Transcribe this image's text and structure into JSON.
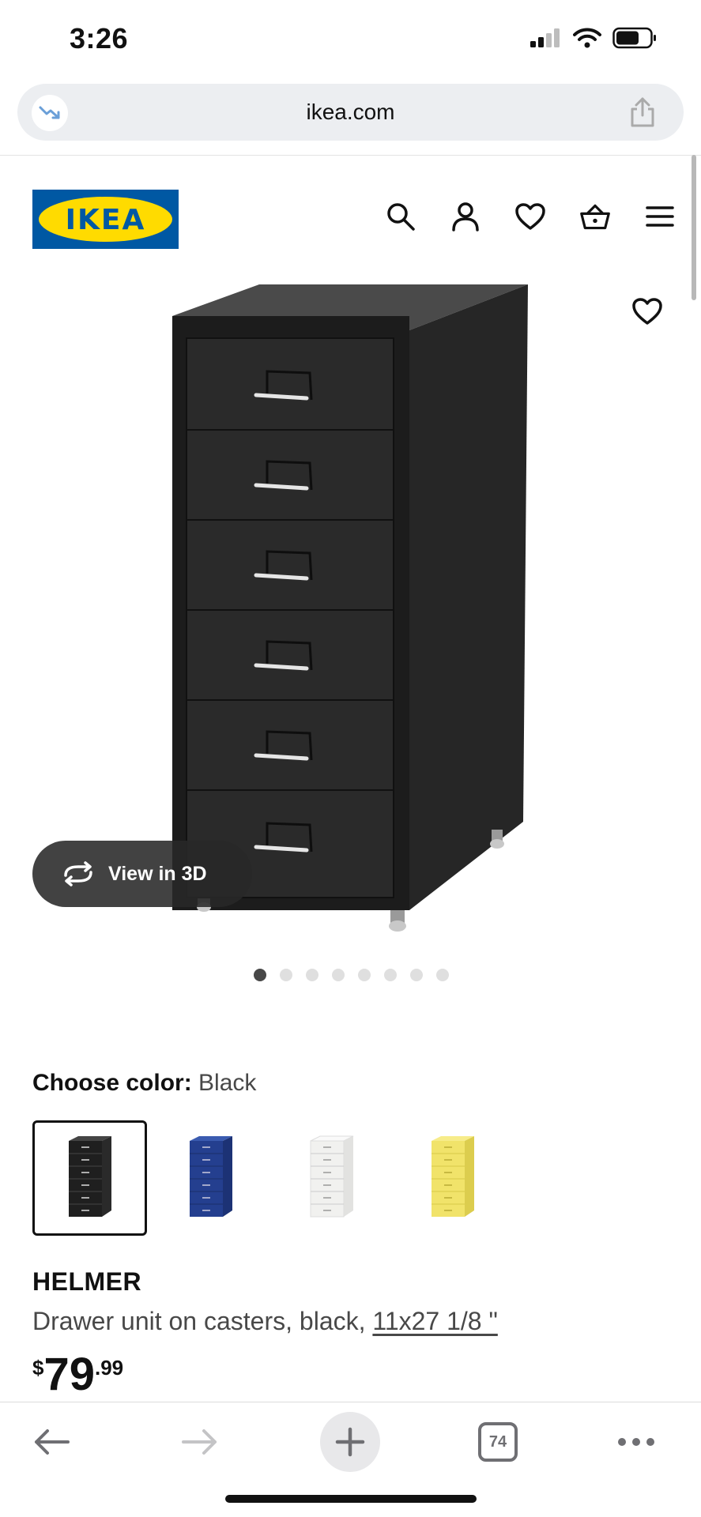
{
  "status_bar": {
    "time": "3:26"
  },
  "browser": {
    "url": "ikea.com",
    "tab_count": "74"
  },
  "header": {
    "logo_text": "IKEA",
    "icons": [
      "search-icon",
      "account-icon",
      "favorites-icon",
      "basket-icon",
      "menu-icon"
    ]
  },
  "gallery": {
    "view_3d_label": "View in 3D",
    "image_count": 8,
    "active_index": 0
  },
  "color_choice": {
    "label": "Choose color:",
    "selected": "Black",
    "options": [
      {
        "name": "Black",
        "color": "#1f1f1f"
      },
      {
        "name": "Blue",
        "color": "#243f8f"
      },
      {
        "name": "White",
        "color": "#f1f1ef"
      },
      {
        "name": "Yellow",
        "color": "#f1e36a"
      }
    ]
  },
  "product": {
    "name": "HELMER",
    "description": "Drawer unit on casters, black, ",
    "measurement": "11x27 1/8 \"",
    "price_currency": "$",
    "price_integer": "79",
    "price_decimal": ".99"
  },
  "colors": {
    "ikea_blue": "#0058a3",
    "ikea_yellow": "#ffdb00",
    "text": "#111111"
  }
}
